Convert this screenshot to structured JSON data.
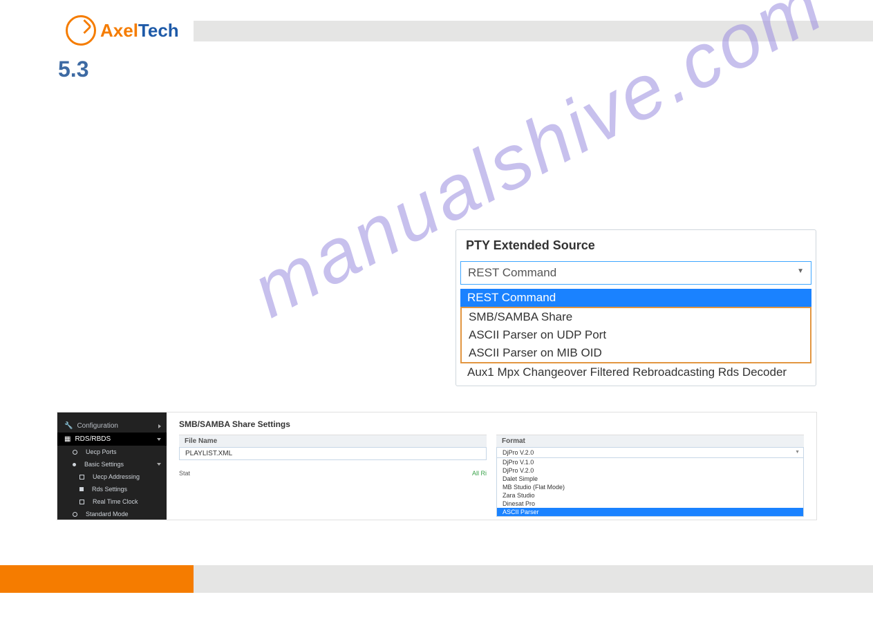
{
  "logo": {
    "brand1": "Axel",
    "brand2": "Tech"
  },
  "section": "5.3",
  "watermark": "manualshive.com",
  "pty": {
    "title": "PTY Extended Source",
    "selected": "REST Command",
    "options": [
      "REST Command",
      "SMB/SAMBA Share",
      "ASCII Parser on UDP Port",
      "ASCII Parser on MIB OID",
      "Aux1 Mpx Changeover Filtered Rebroadcasting Rds Decoder"
    ]
  },
  "sidebar": {
    "config": "Configuration",
    "rds": "RDS/RBDS",
    "items": [
      "Uecp Ports",
      "Basic Settings",
      "Uecp Addressing",
      "Rds Settings",
      "Real Time Clock",
      "Standard Mode"
    ]
  },
  "smb": {
    "title": "SMB/SAMBA Share Settings",
    "file_label": "File Name",
    "file_value": "PLAYLIST.XML",
    "format_label": "Format",
    "format_selected": "DjPro V.2.0",
    "format_options": [
      "DjPro V.1.0",
      "DjPro V.2.0",
      "Dalet Simple",
      "MB Studio (Flat Mode)",
      "Zara Studio",
      "Dinesat Pro",
      "ASCII Parser"
    ],
    "status_left": "Stat",
    "status_right": "All Ri"
  }
}
